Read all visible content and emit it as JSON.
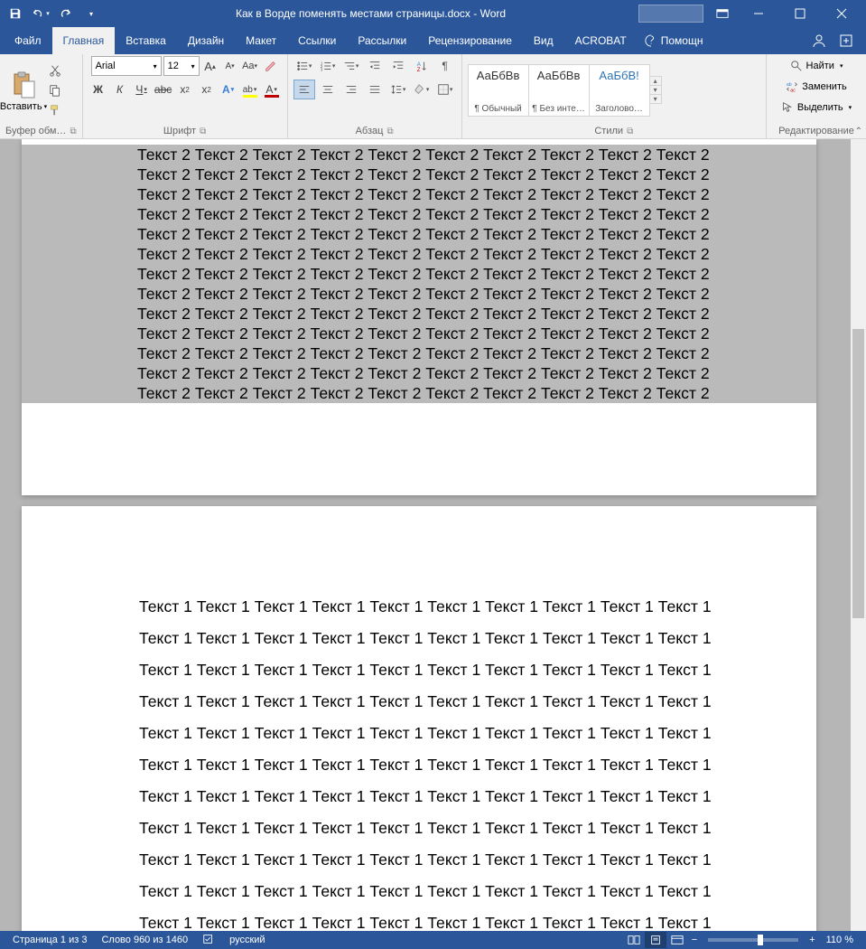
{
  "titlebar": {
    "title": "Как в Ворде поменять местами страницы.docx - Word"
  },
  "tabs": {
    "file": "Файл",
    "home": "Главная",
    "insert": "Вставка",
    "design": "Дизайн",
    "layout": "Макет",
    "references": "Ссылки",
    "mailings": "Рассылки",
    "review": "Рецензирование",
    "view": "Вид",
    "acrobat": "ACROBAT",
    "help": "Помощн"
  },
  "ribbon": {
    "clipboard": {
      "paste": "Вставить",
      "label": "Буфер обм…"
    },
    "font": {
      "name": "Arial",
      "size": "12",
      "bigA": "A",
      "smallA": "A",
      "caseAa": "Aa",
      "label": "Шрифт"
    },
    "paragraph": {
      "label": "Абзац"
    },
    "styles": {
      "items": [
        {
          "preview": "АаБбВв",
          "name": "¶ Обычный"
        },
        {
          "preview": "АаБбВв",
          "name": "¶ Без инте…"
        },
        {
          "preview": "АаБбВ!",
          "name": "Заголово…"
        }
      ],
      "label": "Стили"
    },
    "editing": {
      "find": "Найти",
      "replace": "Заменить",
      "select": "Выделить",
      "label": "Редактирование"
    }
  },
  "document": {
    "page1_token": "Текст 2",
    "page1_repeat_per_line": 10,
    "page1_lines": 13,
    "page2_token": "Текст 1",
    "page2_repeat_per_line": 10,
    "page2_lines": 11
  },
  "statusbar": {
    "page": "Страница 1 из 3",
    "words": "Слово 960 из 1460",
    "lang": "русский",
    "zoom": "110 %"
  }
}
